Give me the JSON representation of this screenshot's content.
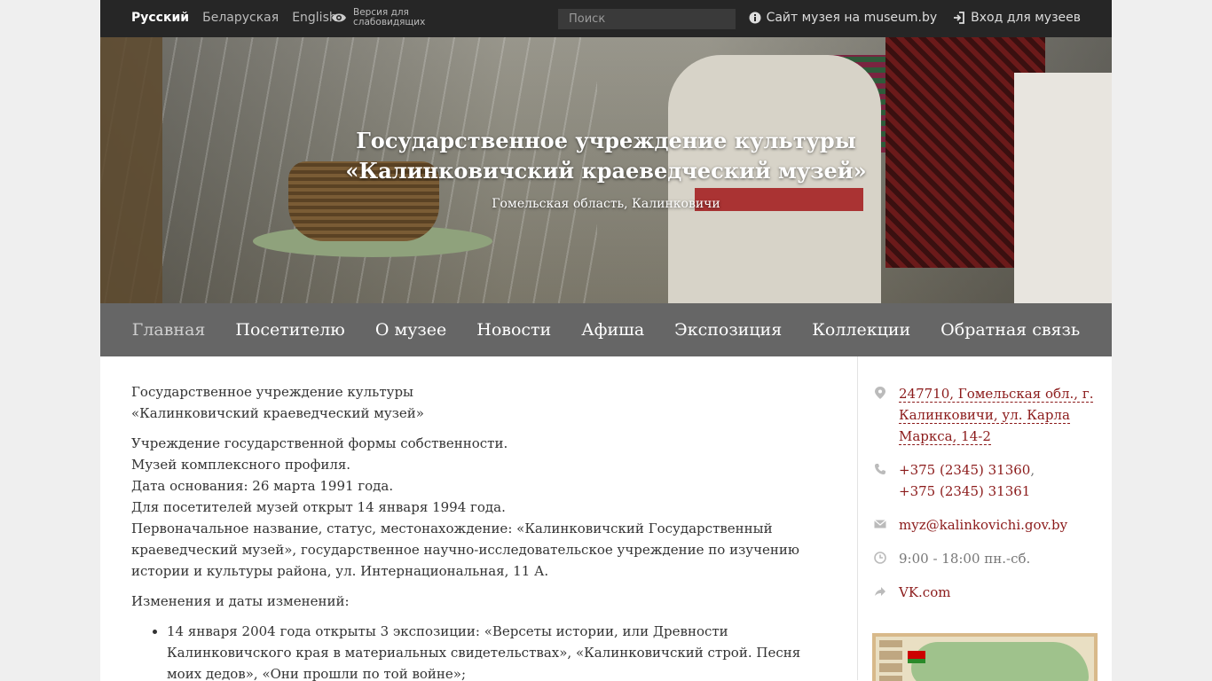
{
  "topbar": {
    "languages": [
      {
        "label": "Русский",
        "active": true
      },
      {
        "label": "Беларуская",
        "active": false
      },
      {
        "label": "English",
        "active": false
      }
    ],
    "low_vision_label": "Версия для слабовидящих",
    "search_placeholder": "Поиск",
    "museum_site_label": "Сайт музея на museum.by",
    "login_label": "Вход для музеев"
  },
  "hero": {
    "title_line1": "Государственное учреждение культуры",
    "title_line2": "«Калинковичский краеведческий музей»",
    "subtitle": "Гомельская область, Калинковичи"
  },
  "nav": {
    "items": [
      {
        "label": "Главная",
        "active": true
      },
      {
        "label": "Посетителю"
      },
      {
        "label": "О музее"
      },
      {
        "label": "Новости"
      },
      {
        "label": "Афиша"
      },
      {
        "label": "Экспозиция"
      },
      {
        "label": "Коллекции"
      },
      {
        "label": "Обратная связь"
      }
    ]
  },
  "main": {
    "intro_line1": "Государственное учреждение культуры",
    "intro_line2": "«Калинковичский краеведческий музей»",
    "facts": [
      "Учреждение государственной формы собственности.",
      "Музей комплексного профиля.",
      "Дата основания: 26 марта 1991 года.",
      "Для посетителей музей открыт 14 января 1994 года.",
      "Первоначальное название, статус, местонахождение: «Калинковичский Государственный краеведческий музей», государственное научно-исследовательское учреждение по изучению истории и культуры района, ул. Интернациональная, 11 А."
    ],
    "changes_heading": "Изменения и даты изменений:",
    "changes": [
      "14 января 2004 года открыты 3 экспозиции: «Версеты истории, или Древности Калинковичского края в материальных свидетельствах», «Калинковичский строй. Песня моих дедов», «Они прошли по той войне»;"
    ]
  },
  "sidebar": {
    "address": "247710, Гомельская обл., г. Калинковичи, ул. Карла Маркса, 14-2",
    "phone1": "+375 (2345) 31360",
    "phone_sep": ",",
    "phone2": "+375 (2345) 31361",
    "email": "myz@kalinkovichi.gov.by",
    "hours": "9:00 - 18:00 пн.-сб.",
    "vk": "VK.com"
  }
}
